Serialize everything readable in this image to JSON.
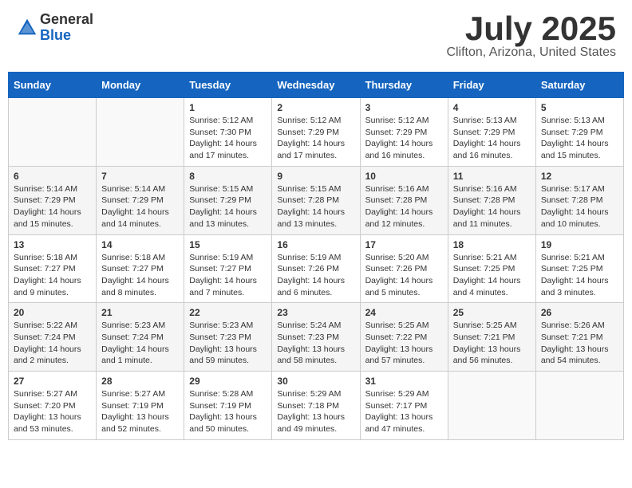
{
  "header": {
    "logo_general": "General",
    "logo_blue": "Blue",
    "month_title": "July 2025",
    "location": "Clifton, Arizona, United States"
  },
  "weekdays": [
    "Sunday",
    "Monday",
    "Tuesday",
    "Wednesday",
    "Thursday",
    "Friday",
    "Saturday"
  ],
  "weeks": [
    [
      {
        "day": "",
        "sunrise": "",
        "sunset": "",
        "daylight": ""
      },
      {
        "day": "",
        "sunrise": "",
        "sunset": "",
        "daylight": ""
      },
      {
        "day": "1",
        "sunrise": "Sunrise: 5:12 AM",
        "sunset": "Sunset: 7:30 PM",
        "daylight": "Daylight: 14 hours and 17 minutes."
      },
      {
        "day": "2",
        "sunrise": "Sunrise: 5:12 AM",
        "sunset": "Sunset: 7:29 PM",
        "daylight": "Daylight: 14 hours and 17 minutes."
      },
      {
        "day": "3",
        "sunrise": "Sunrise: 5:12 AM",
        "sunset": "Sunset: 7:29 PM",
        "daylight": "Daylight: 14 hours and 16 minutes."
      },
      {
        "day": "4",
        "sunrise": "Sunrise: 5:13 AM",
        "sunset": "Sunset: 7:29 PM",
        "daylight": "Daylight: 14 hours and 16 minutes."
      },
      {
        "day": "5",
        "sunrise": "Sunrise: 5:13 AM",
        "sunset": "Sunset: 7:29 PM",
        "daylight": "Daylight: 14 hours and 15 minutes."
      }
    ],
    [
      {
        "day": "6",
        "sunrise": "Sunrise: 5:14 AM",
        "sunset": "Sunset: 7:29 PM",
        "daylight": "Daylight: 14 hours and 15 minutes."
      },
      {
        "day": "7",
        "sunrise": "Sunrise: 5:14 AM",
        "sunset": "Sunset: 7:29 PM",
        "daylight": "Daylight: 14 hours and 14 minutes."
      },
      {
        "day": "8",
        "sunrise": "Sunrise: 5:15 AM",
        "sunset": "Sunset: 7:29 PM",
        "daylight": "Daylight: 14 hours and 13 minutes."
      },
      {
        "day": "9",
        "sunrise": "Sunrise: 5:15 AM",
        "sunset": "Sunset: 7:28 PM",
        "daylight": "Daylight: 14 hours and 13 minutes."
      },
      {
        "day": "10",
        "sunrise": "Sunrise: 5:16 AM",
        "sunset": "Sunset: 7:28 PM",
        "daylight": "Daylight: 14 hours and 12 minutes."
      },
      {
        "day": "11",
        "sunrise": "Sunrise: 5:16 AM",
        "sunset": "Sunset: 7:28 PM",
        "daylight": "Daylight: 14 hours and 11 minutes."
      },
      {
        "day": "12",
        "sunrise": "Sunrise: 5:17 AM",
        "sunset": "Sunset: 7:28 PM",
        "daylight": "Daylight: 14 hours and 10 minutes."
      }
    ],
    [
      {
        "day": "13",
        "sunrise": "Sunrise: 5:18 AM",
        "sunset": "Sunset: 7:27 PM",
        "daylight": "Daylight: 14 hours and 9 minutes."
      },
      {
        "day": "14",
        "sunrise": "Sunrise: 5:18 AM",
        "sunset": "Sunset: 7:27 PM",
        "daylight": "Daylight: 14 hours and 8 minutes."
      },
      {
        "day": "15",
        "sunrise": "Sunrise: 5:19 AM",
        "sunset": "Sunset: 7:27 PM",
        "daylight": "Daylight: 14 hours and 7 minutes."
      },
      {
        "day": "16",
        "sunrise": "Sunrise: 5:19 AM",
        "sunset": "Sunset: 7:26 PM",
        "daylight": "Daylight: 14 hours and 6 minutes."
      },
      {
        "day": "17",
        "sunrise": "Sunrise: 5:20 AM",
        "sunset": "Sunset: 7:26 PM",
        "daylight": "Daylight: 14 hours and 5 minutes."
      },
      {
        "day": "18",
        "sunrise": "Sunrise: 5:21 AM",
        "sunset": "Sunset: 7:25 PM",
        "daylight": "Daylight: 14 hours and 4 minutes."
      },
      {
        "day": "19",
        "sunrise": "Sunrise: 5:21 AM",
        "sunset": "Sunset: 7:25 PM",
        "daylight": "Daylight: 14 hours and 3 minutes."
      }
    ],
    [
      {
        "day": "20",
        "sunrise": "Sunrise: 5:22 AM",
        "sunset": "Sunset: 7:24 PM",
        "daylight": "Daylight: 14 hours and 2 minutes."
      },
      {
        "day": "21",
        "sunrise": "Sunrise: 5:23 AM",
        "sunset": "Sunset: 7:24 PM",
        "daylight": "Daylight: 14 hours and 1 minute."
      },
      {
        "day": "22",
        "sunrise": "Sunrise: 5:23 AM",
        "sunset": "Sunset: 7:23 PM",
        "daylight": "Daylight: 13 hours and 59 minutes."
      },
      {
        "day": "23",
        "sunrise": "Sunrise: 5:24 AM",
        "sunset": "Sunset: 7:23 PM",
        "daylight": "Daylight: 13 hours and 58 minutes."
      },
      {
        "day": "24",
        "sunrise": "Sunrise: 5:25 AM",
        "sunset": "Sunset: 7:22 PM",
        "daylight": "Daylight: 13 hours and 57 minutes."
      },
      {
        "day": "25",
        "sunrise": "Sunrise: 5:25 AM",
        "sunset": "Sunset: 7:21 PM",
        "daylight": "Daylight: 13 hours and 56 minutes."
      },
      {
        "day": "26",
        "sunrise": "Sunrise: 5:26 AM",
        "sunset": "Sunset: 7:21 PM",
        "daylight": "Daylight: 13 hours and 54 minutes."
      }
    ],
    [
      {
        "day": "27",
        "sunrise": "Sunrise: 5:27 AM",
        "sunset": "Sunset: 7:20 PM",
        "daylight": "Daylight: 13 hours and 53 minutes."
      },
      {
        "day": "28",
        "sunrise": "Sunrise: 5:27 AM",
        "sunset": "Sunset: 7:19 PM",
        "daylight": "Daylight: 13 hours and 52 minutes."
      },
      {
        "day": "29",
        "sunrise": "Sunrise: 5:28 AM",
        "sunset": "Sunset: 7:19 PM",
        "daylight": "Daylight: 13 hours and 50 minutes."
      },
      {
        "day": "30",
        "sunrise": "Sunrise: 5:29 AM",
        "sunset": "Sunset: 7:18 PM",
        "daylight": "Daylight: 13 hours and 49 minutes."
      },
      {
        "day": "31",
        "sunrise": "Sunrise: 5:29 AM",
        "sunset": "Sunset: 7:17 PM",
        "daylight": "Daylight: 13 hours and 47 minutes."
      },
      {
        "day": "",
        "sunrise": "",
        "sunset": "",
        "daylight": ""
      },
      {
        "day": "",
        "sunrise": "",
        "sunset": "",
        "daylight": ""
      }
    ]
  ]
}
